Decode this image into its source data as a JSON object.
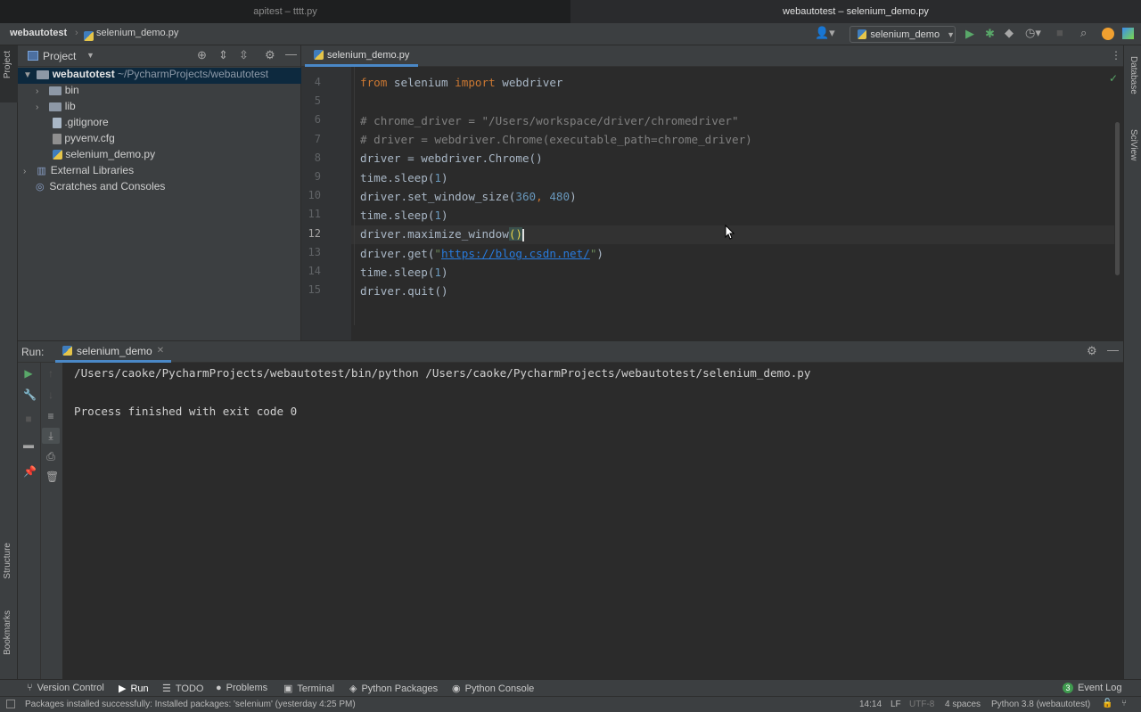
{
  "window_tabs": [
    "apitest – tttt.py",
    "webautotest – selenium_demo.py"
  ],
  "breadcrumb": {
    "project": "webautotest",
    "file": "selenium_demo.py"
  },
  "run_config": "selenium_demo",
  "left_strip": {
    "project": "Project",
    "structure": "Structure",
    "bookmarks": "Bookmarks"
  },
  "right_strip": {
    "database": "Database",
    "sciview": "SciView"
  },
  "project_panel": {
    "title": "Project",
    "root": {
      "name": "webautotest",
      "path": "~/PycharmProjects/webautotest"
    },
    "items": [
      "bin",
      "lib",
      ".gitignore",
      "pyvenv.cfg",
      "selenium_demo.py"
    ],
    "external": "External Libraries",
    "scratches": "Scratches and Consoles"
  },
  "editor": {
    "tab": "selenium_demo.py",
    "line_numbers": [
      "4",
      "5",
      "6",
      "7",
      "8",
      "9",
      "10",
      "11",
      "12",
      "13",
      "14",
      "15"
    ],
    "lines": {
      "l4": {
        "kw1": "from",
        "t1": " selenium ",
        "kw2": "import",
        "t2": " webdriver"
      },
      "l6": "# chrome_driver = \"/Users/workspace/driver/chromedriver\"",
      "l7": "# driver = webdriver.Chrome(executable_path=chrome_driver)",
      "l8": "driver = webdriver.Chrome()",
      "l9": {
        "a": "time.sleep(",
        "n": "1",
        "b": ")"
      },
      "l10": {
        "a": "driver.set_window_size(",
        "n1": "360",
        "c": ", ",
        "n2": "480",
        "b": ")"
      },
      "l11": {
        "a": "time.sleep(",
        "n": "1",
        "b": ")"
      },
      "l12": {
        "a": "driver.maximize_window",
        "b": "()"
      },
      "l13": {
        "a": "driver.get(",
        "q1": "\"",
        "url": "https://blog.csdn.net/",
        "q2": "\"",
        "b": ")"
      },
      "l14": {
        "a": "time.sleep(",
        "n": "1",
        "b": ")"
      },
      "l15": "driver.quit()"
    }
  },
  "run_panel": {
    "label": "Run:",
    "tab": "selenium_demo",
    "output": [
      "/Users/caoke/PycharmProjects/webautotest/bin/python /Users/caoke/PycharmProjects/webautotest/selenium_demo.py",
      "Process finished with exit code 0"
    ]
  },
  "bottom_tabs": [
    "Version Control",
    "Run",
    "TODO",
    "Problems",
    "Terminal",
    "Python Packages",
    "Python Console"
  ],
  "event_log": {
    "badge": "3",
    "label": "Event Log"
  },
  "status": {
    "message": "Packages installed successfully: Installed packages: 'selenium' (yesterday 4:25 PM)",
    "position": "14:14",
    "line_sep": "LF",
    "encoding": "UTF-8",
    "indent": "4 spaces",
    "interpreter": "Python 3.8 (webautotest)"
  }
}
